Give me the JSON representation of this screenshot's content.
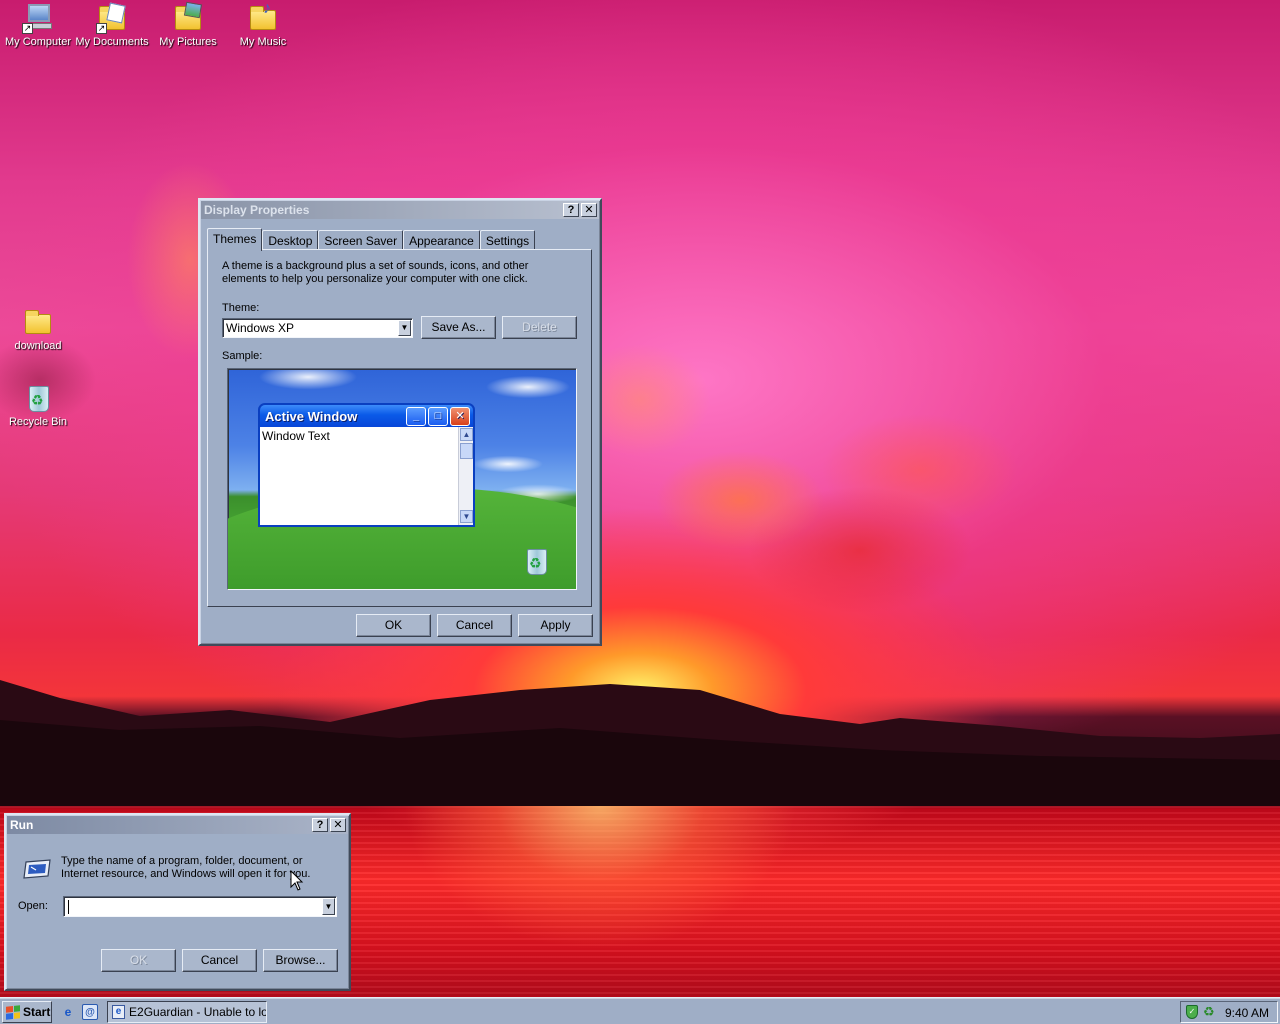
{
  "desktop": {
    "icons": [
      {
        "label": "My Computer",
        "icon": "my-computer-icon"
      },
      {
        "label": "My Documents",
        "icon": "my-documents-icon"
      },
      {
        "label": "My Pictures",
        "icon": "my-pictures-icon"
      },
      {
        "label": "My Music",
        "icon": "my-music-icon"
      },
      {
        "label": "download",
        "icon": "folder-icon"
      },
      {
        "label": "Recycle Bin",
        "icon": "recycle-bin-icon"
      }
    ]
  },
  "display_properties": {
    "title": "Display Properties",
    "help_btn": "?",
    "close_btn": "✕",
    "tabs": [
      "Themes",
      "Desktop",
      "Screen Saver",
      "Appearance",
      "Settings"
    ],
    "selected_tab": "Themes",
    "description": "A theme is a background plus a set of sounds, icons, and other elements to help you personalize your computer with one click.",
    "theme_label": "Theme:",
    "theme_value": "Windows XP",
    "save_as": "Save As...",
    "delete": "Delete",
    "sample_label": "Sample:",
    "sample": {
      "active_window_title": "Active Window",
      "window_text": "Window Text"
    },
    "ok": "OK",
    "cancel": "Cancel",
    "apply": "Apply"
  },
  "run_dialog": {
    "title": "Run",
    "help_btn": "?",
    "close_btn": "✕",
    "description": "Type the name of a program, folder, document, or Internet resource, and Windows will open it for you.",
    "open_label": "Open:",
    "open_value": "",
    "ok": "OK",
    "cancel": "Cancel",
    "browse": "Browse..."
  },
  "taskbar": {
    "start_label": "Start",
    "task_button": "E2Guardian - Unable to lo...",
    "clock": "9:40 AM"
  },
  "colors": {
    "window_face": "#9faec6",
    "xp_title_blue": "#0a5ae8",
    "wallpaper_pink": "#e23a8e",
    "wallpaper_red": "#ff2a2a"
  }
}
